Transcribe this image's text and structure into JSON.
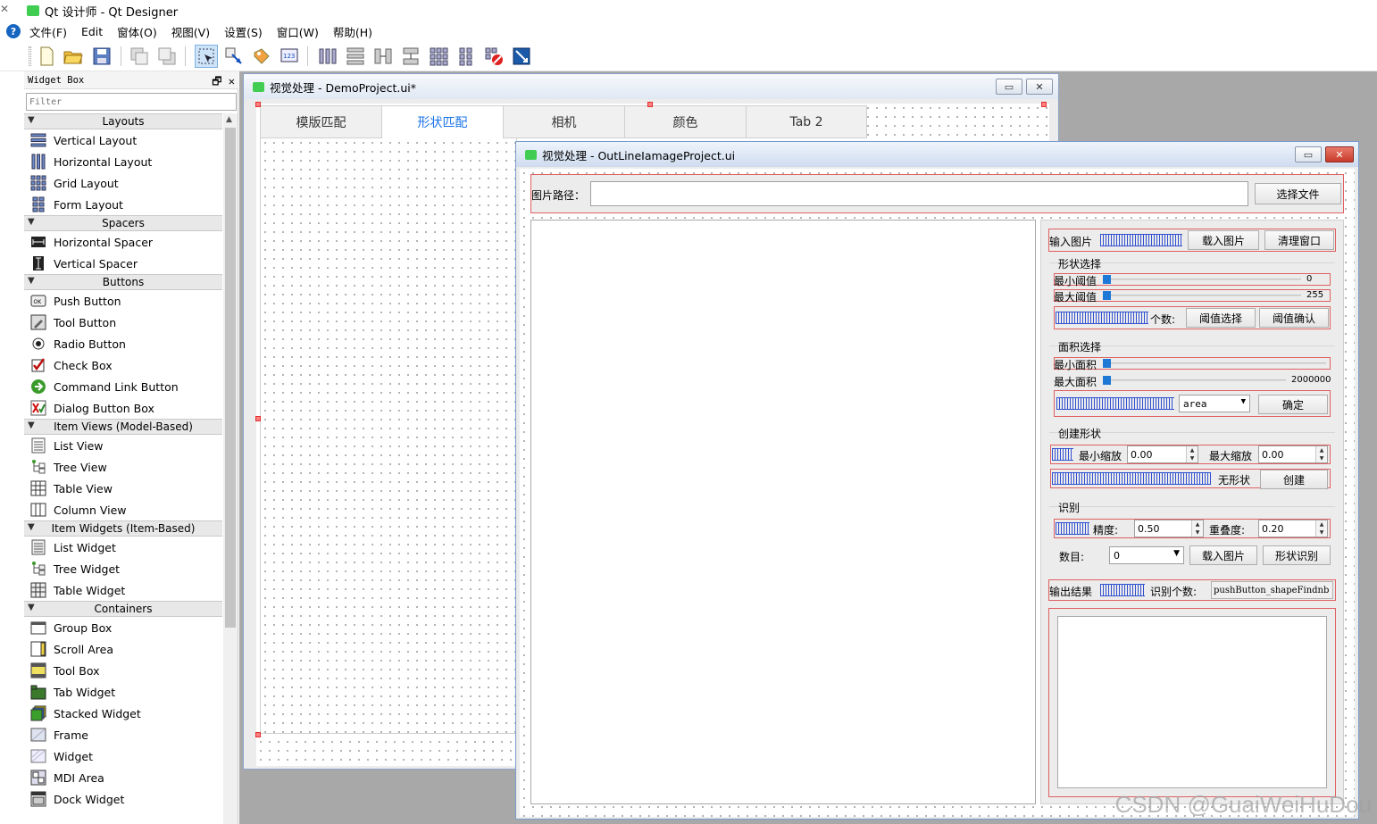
{
  "app": {
    "title": "Qt 设计师 - Qt Designer"
  },
  "menu": [
    "文件(F)",
    "Edit",
    "窗体(O)",
    "视图(V)",
    "设置(S)",
    "窗口(W)",
    "帮助(H)"
  ],
  "widget_box": {
    "title": "Widget Box",
    "dock_buttons": "🗗 ✕",
    "filter_placeholder": "Filter",
    "categories": [
      {
        "name": "Layouts",
        "items": [
          {
            "label": "Vertical Layout",
            "icon": "vertical-layout-icon"
          },
          {
            "label": "Horizontal Layout",
            "icon": "horizontal-layout-icon"
          },
          {
            "label": "Grid Layout",
            "icon": "grid-layout-icon"
          },
          {
            "label": "Form Layout",
            "icon": "form-layout-icon"
          }
        ]
      },
      {
        "name": "Spacers",
        "items": [
          {
            "label": "Horizontal Spacer",
            "icon": "horizontal-spacer-icon"
          },
          {
            "label": "Vertical Spacer",
            "icon": "vertical-spacer-icon"
          }
        ]
      },
      {
        "name": "Buttons",
        "items": [
          {
            "label": "Push Button",
            "icon": "push-button-icon"
          },
          {
            "label": "Tool Button",
            "icon": "tool-button-icon"
          },
          {
            "label": "Radio Button",
            "icon": "radio-button-icon"
          },
          {
            "label": "Check Box",
            "icon": "check-box-icon"
          },
          {
            "label": "Command Link Button",
            "icon": "command-link-icon"
          },
          {
            "label": "Dialog Button Box",
            "icon": "dialog-button-box-icon"
          }
        ]
      },
      {
        "name": "Item Views (Model-Based)",
        "items": [
          {
            "label": "List View",
            "icon": "list-view-icon"
          },
          {
            "label": "Tree View",
            "icon": "tree-view-icon"
          },
          {
            "label": "Table View",
            "icon": "table-view-icon"
          },
          {
            "label": "Column View",
            "icon": "column-view-icon"
          }
        ]
      },
      {
        "name": "Item Widgets (Item-Based)",
        "items": [
          {
            "label": "List Widget",
            "icon": "list-widget-icon"
          },
          {
            "label": "Tree Widget",
            "icon": "tree-widget-icon"
          },
          {
            "label": "Table Widget",
            "icon": "table-widget-icon"
          }
        ]
      },
      {
        "name": "Containers",
        "items": [
          {
            "label": "Group Box",
            "icon": "group-box-icon"
          },
          {
            "label": "Scroll Area",
            "icon": "scroll-area-icon"
          },
          {
            "label": "Tool Box",
            "icon": "tool-box-icon"
          },
          {
            "label": "Tab Widget",
            "icon": "tab-widget-icon"
          },
          {
            "label": "Stacked Widget",
            "icon": "stacked-widget-icon"
          },
          {
            "label": "Frame",
            "icon": "frame-icon"
          },
          {
            "label": "Widget",
            "icon": "widget-icon"
          },
          {
            "label": "MDI Area",
            "icon": "mdi-area-icon"
          },
          {
            "label": "Dock Widget",
            "icon": "dock-widget-icon"
          }
        ]
      }
    ]
  },
  "win1": {
    "title": "视觉处理 - DemoProject.ui*",
    "tabs": [
      "模版匹配",
      "形状匹配",
      "相机",
      "颜色",
      "Tab 2"
    ],
    "active_tab": 1
  },
  "win2": {
    "title": "视觉处理 - OutLineIamageProject.ui",
    "path_label": "图片路径：",
    "path_value": "",
    "select_file": "选择文件",
    "input_image_label": "输入图片",
    "load_image": "载入图片",
    "clear_window": "清理窗口",
    "shape_select": {
      "title": "形状选择",
      "min_thresh_label": "最小阈值",
      "min_thresh_value": "0",
      "max_thresh_label": "最大阈值",
      "max_thresh_value": "255",
      "count_label": "个数:",
      "thresh_select": "阈值选择",
      "thresh_confirm": "阈值确认"
    },
    "area_select": {
      "title": "面积选择",
      "min_area_label": "最小面积",
      "max_area_label": "最大面积",
      "max_area_value": "2000000",
      "combo_value": "area",
      "confirm": "确定"
    },
    "create_shape": {
      "title": "创建形状",
      "min_scale_label": "最小缩放",
      "min_scale_value": "0.00",
      "max_scale_label": "最大缩放",
      "max_scale_value": "0.00",
      "no_shape": "无形状",
      "create": "创建"
    },
    "recognize": {
      "title": "识别",
      "precision_label": "精度:",
      "precision_value": "0.50",
      "overlap_label": "重叠度:",
      "overlap_value": "0.20",
      "count_label": "数目:",
      "count_value": "0",
      "load_image": "载入图片",
      "shape_recognize": "形状识别"
    },
    "output": {
      "label": "输出结果",
      "count_label": "识别个数:",
      "count_button": "pushButton_shapeFindnb"
    }
  },
  "watermark": "CSDN @GuaiWeiHuDou"
}
